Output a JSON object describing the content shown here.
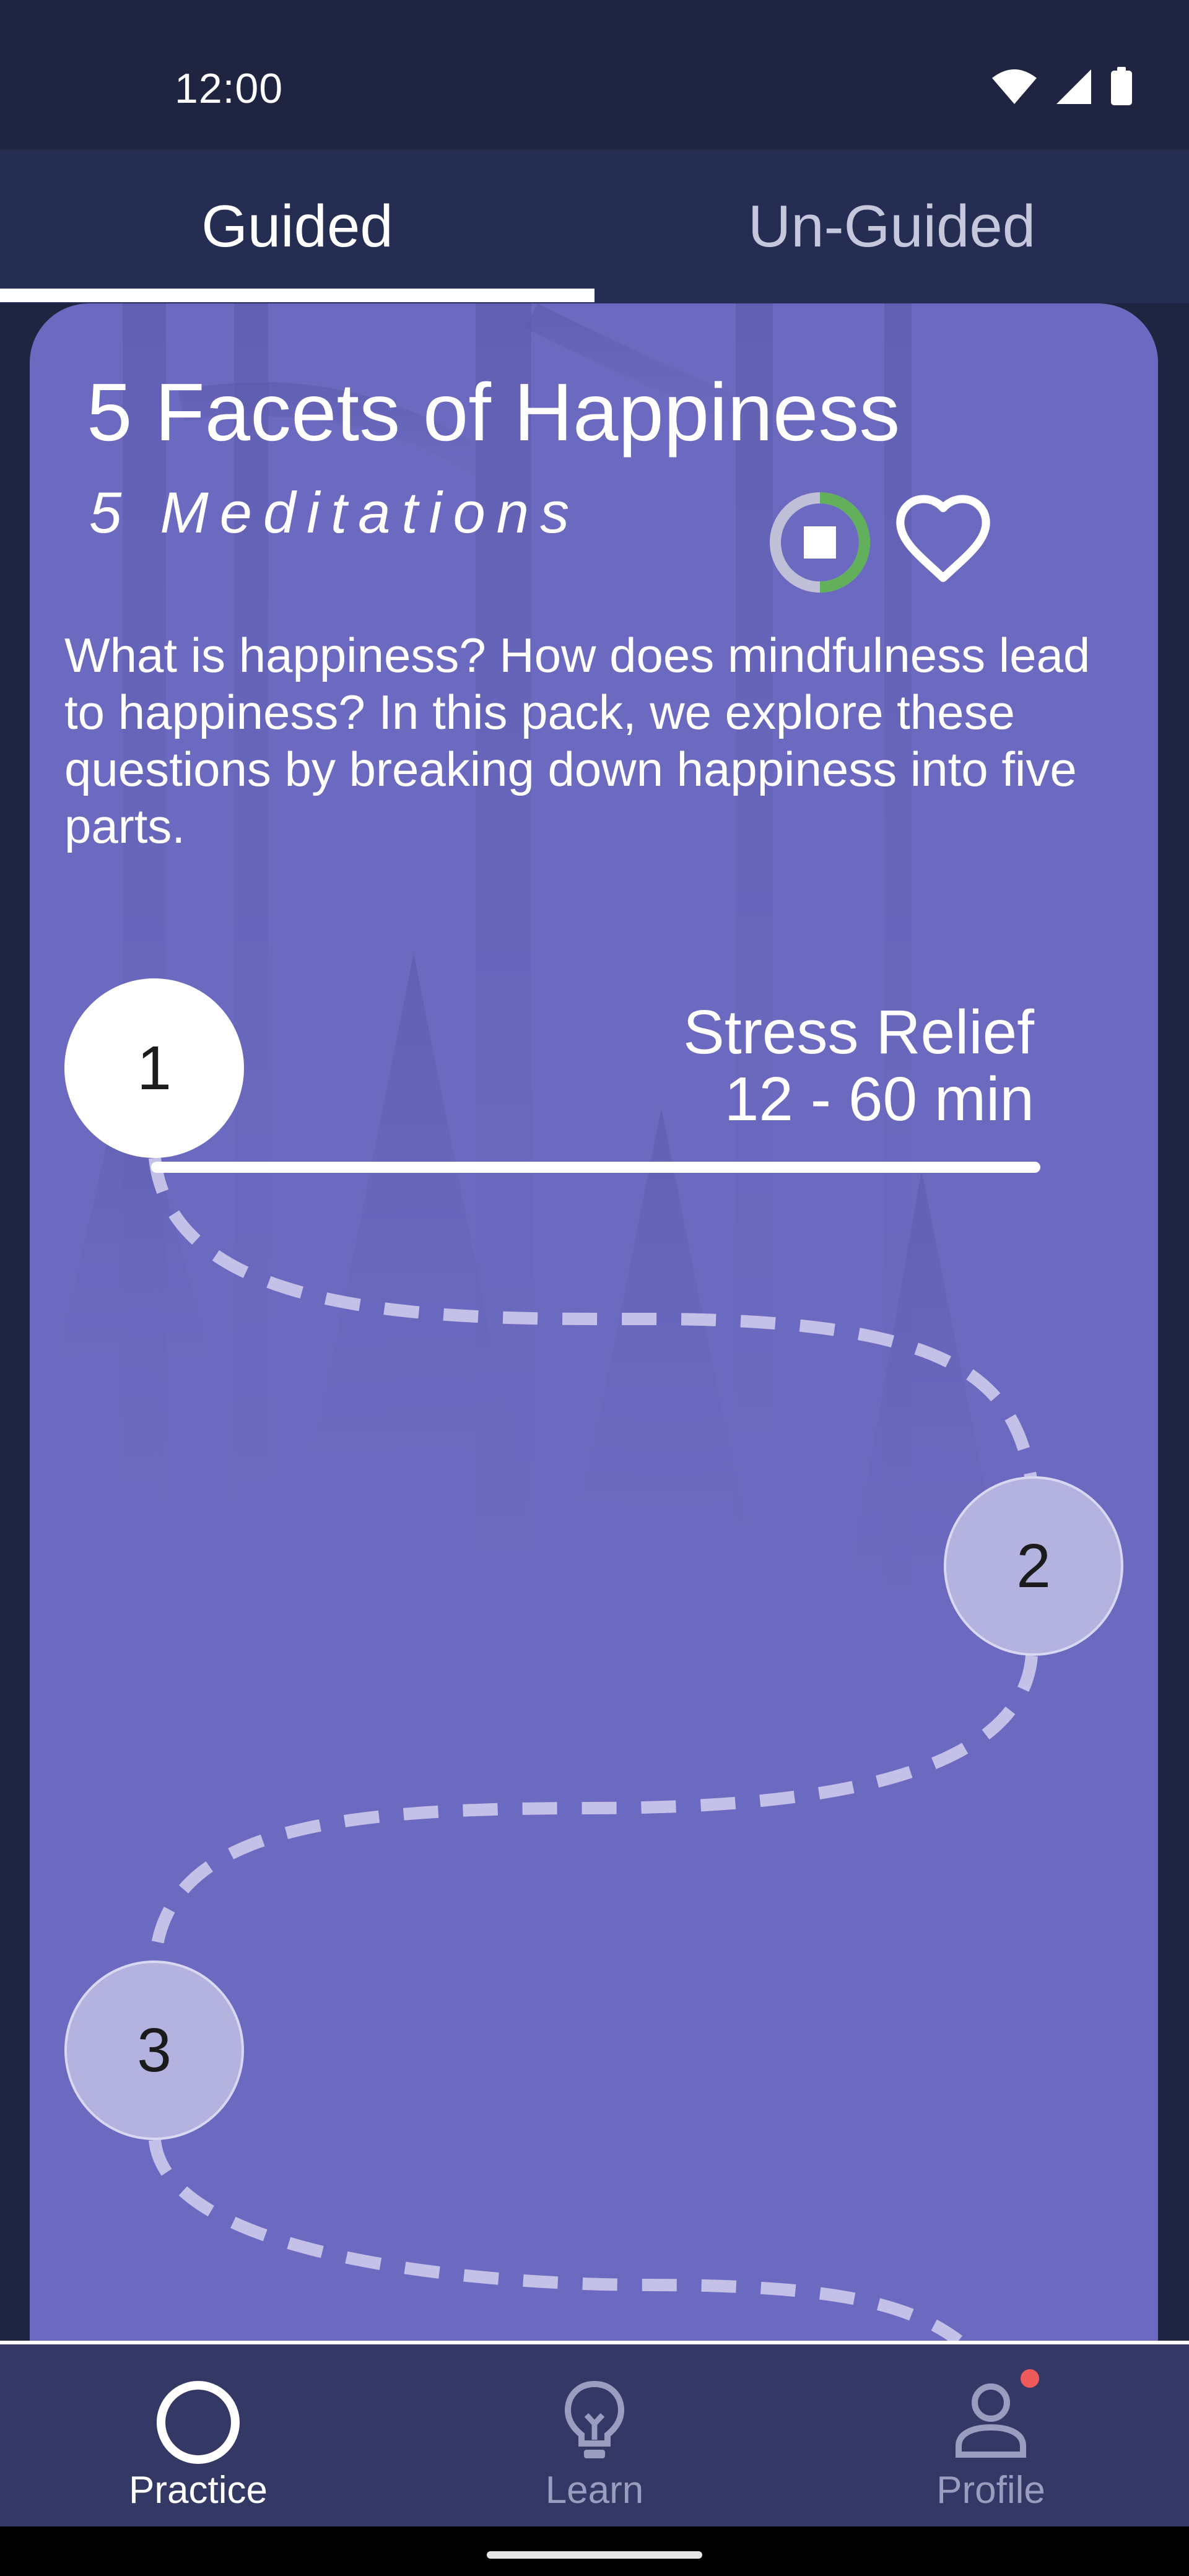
{
  "status_bar": {
    "time": "12:00",
    "icons": [
      "wifi-icon",
      "signal-icon",
      "battery-icon"
    ]
  },
  "tabs": [
    {
      "label": "Guided",
      "selected": true
    },
    {
      "label": "Un-Guided",
      "selected": false
    }
  ],
  "pack": {
    "title": "5 Facets of Happiness",
    "subtitle": "5 Meditations",
    "description": "What is happiness? How does mindfulness lead to happiness? In this pack, we explore these questions by breaking down happiness into five parts.",
    "progress_fraction": 0.5,
    "favorited": false
  },
  "steps": [
    {
      "number": "1",
      "title": "Stress Relief",
      "duration": "12 - 60 min",
      "active": true
    },
    {
      "number": "2",
      "active": false
    },
    {
      "number": "3",
      "active": false
    }
  ],
  "bottom_nav": [
    {
      "label": "Practice",
      "icon": "circle-icon",
      "selected": true
    },
    {
      "label": "Learn",
      "icon": "lightbulb-icon",
      "selected": false
    },
    {
      "label": "Profile",
      "icon": "person-icon",
      "selected": false,
      "notification": true
    }
  ],
  "colors": {
    "background": "#1f2540",
    "tab_bar": "#262d52",
    "card": "#6c6ac0",
    "node_inactive": "#b4b2df",
    "progress_green": "#62b05b",
    "nav_bar": "#343864",
    "notification": "#ee5a5a"
  }
}
